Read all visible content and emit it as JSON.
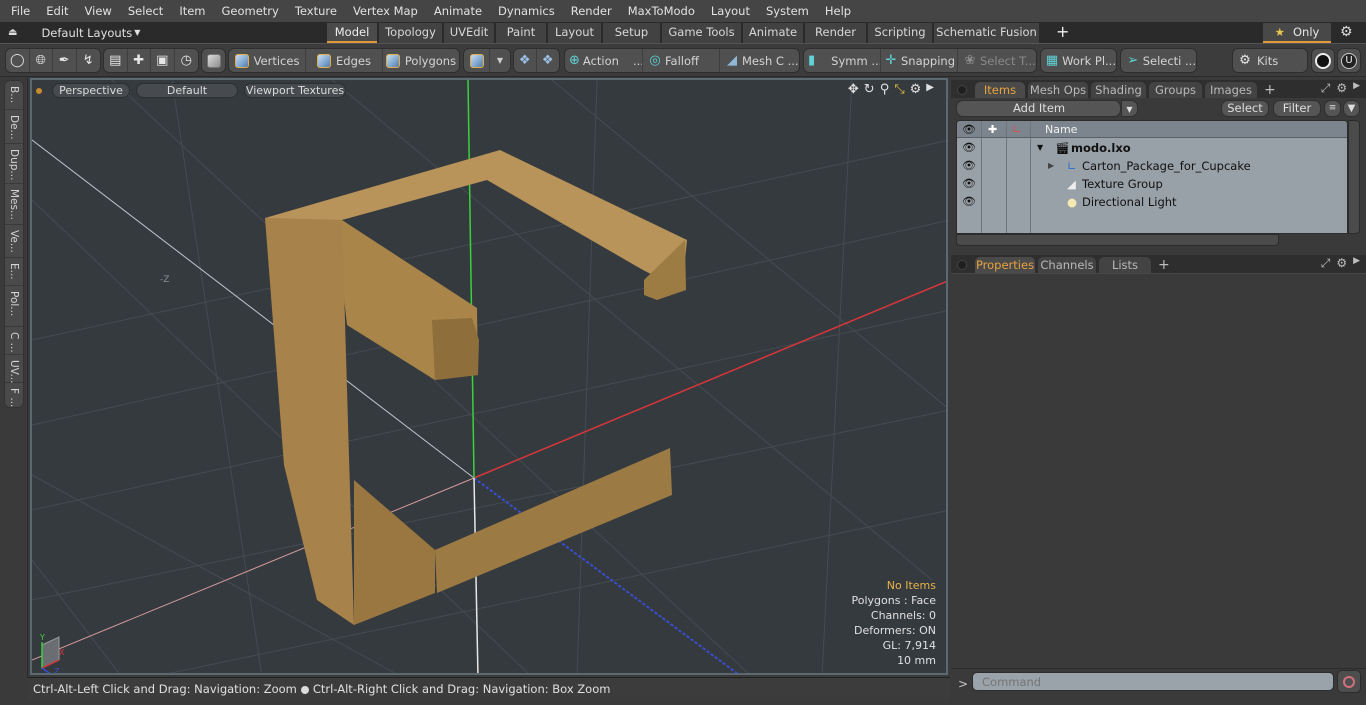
{
  "menu": [
    "File",
    "Edit",
    "View",
    "Select",
    "Item",
    "Geometry",
    "Texture",
    "Vertex Map",
    "Animate",
    "Dynamics",
    "Render",
    "MaxToModo",
    "Layout",
    "System",
    "Help"
  ],
  "layouts": {
    "label": "Default Layouts",
    "icon": "eject-icon"
  },
  "layout_tabs": [
    {
      "label": "Model",
      "active": true
    },
    {
      "label": "Topology"
    },
    {
      "label": "UVEdit"
    },
    {
      "label": "Paint"
    },
    {
      "label": "Layout"
    },
    {
      "label": "Setup"
    },
    {
      "label": "Game Tools"
    },
    {
      "label": "Animate"
    },
    {
      "label": "Render"
    },
    {
      "label": "Scripting"
    },
    {
      "label": "Schematic Fusion"
    }
  ],
  "tabbar_right": {
    "only_label": "Only",
    "star_icon": "star-icon",
    "gear_icon": "gear-icon"
  },
  "toolbar": {
    "components": {
      "vertices": "Vertices",
      "edges": "Edges",
      "polygons": "Polygons"
    },
    "action": "Action",
    "action_more": "...",
    "falloff": "Falloff",
    "mesh_c": "Mesh C ...",
    "symm": "Symm ...",
    "snapping": "Snapping",
    "select_t": "Select T...",
    "work_pl": "Work Pl...",
    "selecti": "Selecti ...",
    "kits": "Kits"
  },
  "left_strip": [
    "B...",
    "De...",
    "Dup...",
    "Mes...",
    "Ve...",
    "E...",
    "Pol...",
    "C ...",
    "UV...",
    "F ..."
  ],
  "viewport": {
    "view_mode": "Perspective",
    "shading": "Default",
    "textures": "Viewport Textures",
    "axis_label_neg_z": "-Z",
    "info": {
      "selection": "No Items",
      "polygons": "Polygons : Face",
      "channels": "Channels: 0",
      "deformers": "Deformers: ON",
      "gl": "GL: 7,914",
      "grid": "10 mm"
    },
    "accent_color": "#e8b34a",
    "mesh_color": "#b08a4e",
    "axis_colors": {
      "x": "#d8363a",
      "y": "#3ad23a",
      "z": "#3a4ed8"
    }
  },
  "statusbar": {
    "hint_left": "Ctrl-Alt-Left Click and Drag: Navigation: Zoom",
    "hint_right": "Ctrl-Alt-Right Click and Drag: Navigation: Box Zoom"
  },
  "items_panel": {
    "tabs": [
      {
        "label": "Items",
        "active": true
      },
      {
        "label": "Mesh Ops"
      },
      {
        "label": "Shading"
      },
      {
        "label": "Groups"
      },
      {
        "label": "Images"
      }
    ],
    "add_item": "Add Item",
    "select": "Select",
    "filter": "Filter",
    "column_name": "Name",
    "items": [
      {
        "name": "modo.lxo",
        "icon": "scene-clapper-icon",
        "bold": true,
        "expanded": true
      },
      {
        "name": "Carton_Package_for_Cupcake",
        "icon": "mesh-locator-icon",
        "collapsed": true
      },
      {
        "name": "Texture Group",
        "icon": "texture-group-icon"
      },
      {
        "name": "Directional Light",
        "icon": "directional-light-icon"
      }
    ]
  },
  "properties_panel": {
    "tabs": [
      {
        "label": "Properties",
        "active": true
      },
      {
        "label": "Channels"
      },
      {
        "label": "Lists"
      }
    ]
  },
  "command": {
    "prompt": ">",
    "placeholder": "Command"
  }
}
